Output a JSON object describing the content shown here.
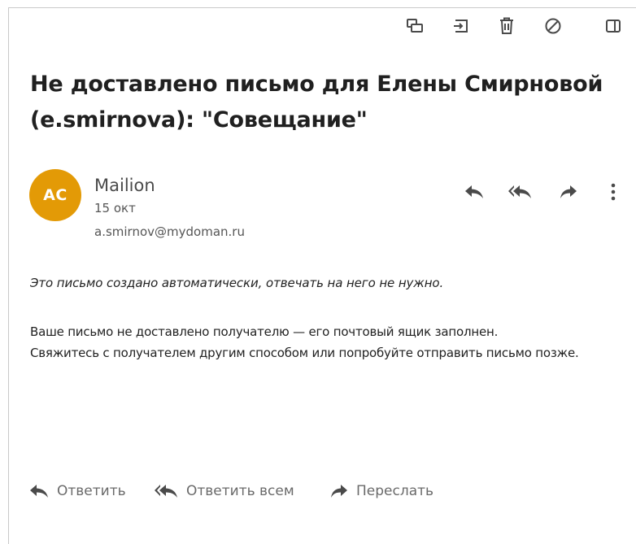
{
  "subject": {
    "line1": "Не доставлено письмо для Елены Смирновой",
    "line2": "(e.smirnova): \"Совещание\""
  },
  "sender": {
    "initials": "AC",
    "avatar_color": "#e39a06",
    "name": "Mailion",
    "date": "15 окт",
    "email": "a.smirnov@mydoman.ru"
  },
  "toolbar": {
    "icons": [
      "move-to-folder-icon",
      "archive-icon",
      "trash-icon",
      "block-icon",
      "side-panel-icon"
    ]
  },
  "message_actions": {
    "icons": [
      "reply-icon",
      "reply-all-icon",
      "forward-icon",
      "more-vertical-icon"
    ]
  },
  "body": {
    "auto_note": "Это письмо создано автоматически, отвечать на него не нужно.",
    "line1": "Ваше письмо не доставлено получателю — его почтовый ящик заполнен.",
    "line2": "Свяжитесь с получателем другим способом или попробуйте отправить письмо позже."
  },
  "footer_actions": {
    "reply": "Ответить",
    "reply_all": "Ответить всем",
    "forward": "Переслать"
  },
  "colors": {
    "icon": "#4a4a4a",
    "footer_text": "#6a6a6a"
  }
}
